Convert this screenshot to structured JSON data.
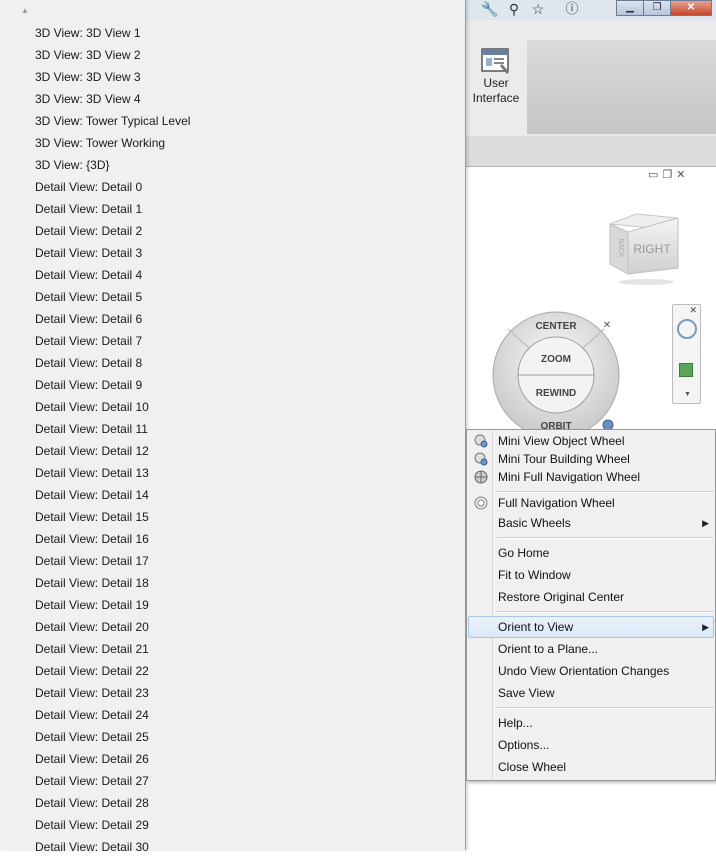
{
  "title_bar": {
    "icons": [
      "wrench-icon",
      "binoculars-icon",
      "star-icon",
      "help-icon"
    ],
    "window_buttons": [
      "minimize",
      "maximize",
      "close"
    ]
  },
  "ribbon": {
    "user_interface_line1": "User",
    "user_interface_line2": "Interface"
  },
  "viewcube": {
    "face_label": "RIGHT",
    "side_label": "BACK"
  },
  "steering_wheel": {
    "center": "CENTER",
    "zoom": "ZOOM",
    "rewind": "REWIND",
    "orbit": "ORBIT"
  },
  "view_list": {
    "items": [
      "3D View: 3D View 1",
      "3D View: 3D View 2",
      "3D View: 3D View 3",
      "3D View: 3D View 4",
      "3D View: Tower Typical Level",
      "3D View: Tower Working",
      "3D View: {3D}",
      "Detail View: Detail 0",
      "Detail View: Detail 1",
      "Detail View: Detail 2",
      "Detail View: Detail 3",
      "Detail View: Detail 4",
      "Detail View: Detail 5",
      "Detail View: Detail 6",
      "Detail View: Detail 7",
      "Detail View: Detail 8",
      "Detail View: Detail 9",
      "Detail View: Detail 10",
      "Detail View: Detail 11",
      "Detail View: Detail 12",
      "Detail View: Detail 13",
      "Detail View: Detail 14",
      "Detail View: Detail 15",
      "Detail View: Detail 16",
      "Detail View: Detail 17",
      "Detail View: Detail 18",
      "Detail View: Detail 19",
      "Detail View: Detail 20",
      "Detail View: Detail 21",
      "Detail View: Detail 22",
      "Detail View: Detail 23",
      "Detail View: Detail 24",
      "Detail View: Detail 25",
      "Detail View: Detail 26",
      "Detail View: Detail 27",
      "Detail View: Detail 28",
      "Detail View: Detail 29",
      "Detail View: Detail 30"
    ]
  },
  "context_menu": {
    "mini_view_object_wheel": "Mini View Object Wheel",
    "mini_tour_building_wheel": "Mini Tour Building Wheel",
    "mini_full_navigation_wheel": "Mini Full Navigation Wheel",
    "full_navigation_wheel": "Full Navigation Wheel",
    "basic_wheels": "Basic Wheels",
    "go_home": "Go Home",
    "fit_to_window": "Fit to Window",
    "restore_original_center": "Restore Original Center",
    "orient_to_view": "Orient to View",
    "orient_to_a_plane": "Orient to a Plane...",
    "undo_view_orientation_changes": "Undo View Orientation Changes",
    "save_view": "Save View",
    "help": "Help...",
    "options": "Options...",
    "close_wheel": "Close Wheel",
    "highlighted_item": "Orient to View"
  }
}
